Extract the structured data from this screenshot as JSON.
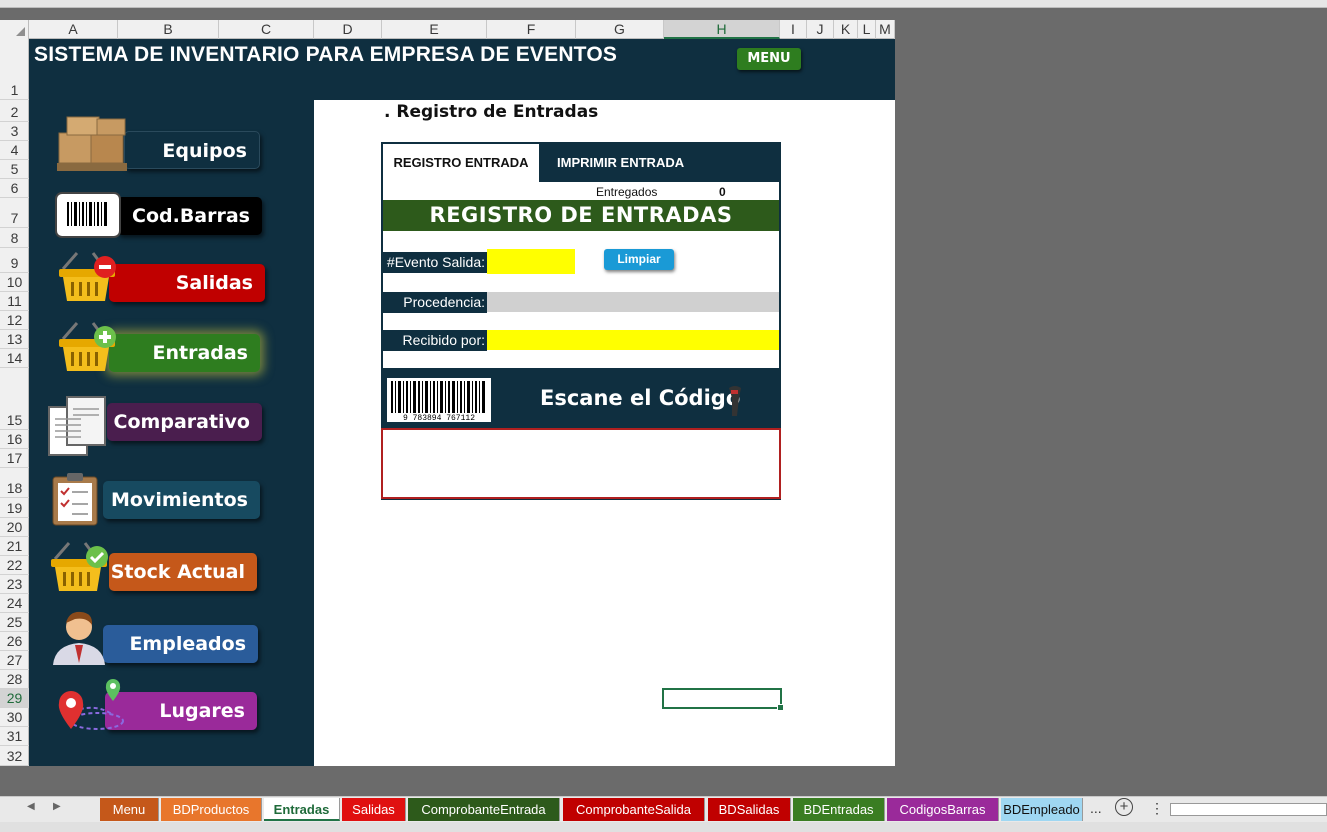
{
  "columns": [
    "A",
    "B",
    "C",
    "D",
    "E",
    "F",
    "G",
    "H",
    "I",
    "J",
    "K",
    "L",
    "M"
  ],
  "selected_column": "H",
  "rows": [
    "1",
    "2",
    "3",
    "4",
    "5",
    "6",
    "7",
    "8",
    "9",
    "10",
    "11",
    "12",
    "13",
    "14",
    "15",
    "16",
    "17",
    "18",
    "19",
    "20",
    "21",
    "22",
    "23",
    "24",
    "25",
    "26",
    "27",
    "28",
    "29",
    "30",
    "31",
    "32"
  ],
  "selected_row": "29",
  "header": {
    "title": "SISTEMA DE INVENTARIO PARA EMPRESA DE EVENTOS",
    "menu_label": "MENU"
  },
  "nav": [
    {
      "label": "Equipos",
      "color": "#0f2f40",
      "icon": "boxes-pallet-icon"
    },
    {
      "label": "Cod.Barras",
      "color": "#000000",
      "icon": "barcode-label-icon"
    },
    {
      "label": "Salidas",
      "color": "#c00000",
      "icon": "basket-minus-icon"
    },
    {
      "label": "Entradas",
      "color": "#2e7d1f",
      "icon": "basket-plus-icon"
    },
    {
      "label": "Comparativo",
      "color": "#4a1e4e",
      "icon": "documents-icon"
    },
    {
      "label": "Movimientos",
      "color": "#174a60",
      "icon": "clipboard-icon"
    },
    {
      "label": "Stock Actual",
      "color": "#c5581a",
      "icon": "basket-check-icon"
    },
    {
      "label": "Empleados",
      "color": "#2a5c9a",
      "icon": "employee-icon"
    },
    {
      "label": "Lugares",
      "color": "#9a2a9a",
      "icon": "map-pins-icon"
    }
  ],
  "form": {
    "page_heading": ". Registro de Entradas",
    "tab_register": "REGISTRO ENTRADA",
    "tab_print": "IMPRIMIR ENTRADA",
    "delivered_label": "Entregados",
    "delivered_value": "0",
    "banner": "REGISTRO DE ENTRADAS",
    "event_label": "#Evento Salida:",
    "clear_button": "Limpiar",
    "origin_label": "Procedencia:",
    "received_label": "Recibido por:",
    "scan_text": "Escane el Código",
    "barcode_number": "9 783894 767112"
  },
  "sheet_tabs": [
    {
      "label": "Menu",
      "color": "#c5581a"
    },
    {
      "label": "BDProductos",
      "color": "#e8762c"
    },
    {
      "label": "Entradas",
      "color": "#ffffff",
      "active": true
    },
    {
      "label": "Salidas",
      "color": "#e01010"
    },
    {
      "label": "ComprobanteEntrada",
      "color": "#2d5a1b"
    },
    {
      "label": "ComprobanteSalida",
      "color": "#c00000"
    },
    {
      "label": "BDSalidas",
      "color": "#c00000"
    },
    {
      "label": "BDEntradas",
      "color": "#3a7d22"
    },
    {
      "label": "CodigosBarras",
      "color": "#9a2a9a"
    },
    {
      "label": "BDEmpleado",
      "color": "#9fd7f2"
    }
  ],
  "tabs_more": "...",
  "add_sheet": "+",
  "colors": {
    "sheet_bg": "#0f2f40",
    "yellow": "#ffff00",
    "gray_field": "#d0d0d0",
    "excel_green": "#217346"
  }
}
